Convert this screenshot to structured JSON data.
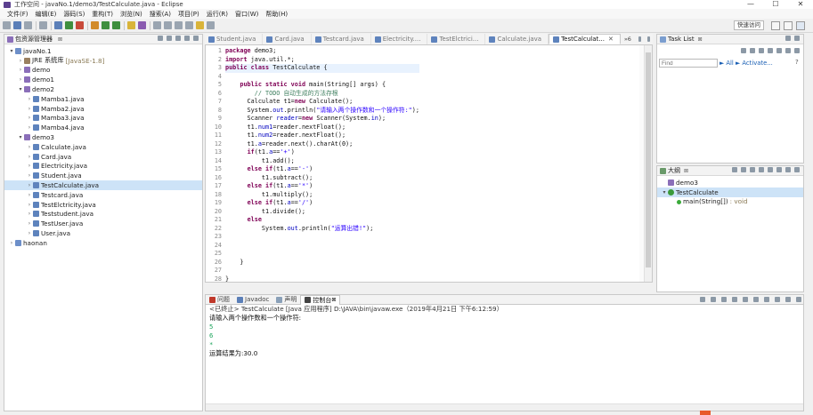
{
  "window": {
    "title": "工作空间 - javaNo.1/demo3/TestCalculate.java - Eclipse",
    "controls": [
      "—",
      "☐",
      "✕"
    ]
  },
  "menu": [
    "文件(F)",
    "编辑(E)",
    "源码(S)",
    "重构(T)",
    "浏览(N)",
    "搜索(A)",
    "项目(P)",
    "运行(R)",
    "窗口(W)",
    "帮助(H)"
  ],
  "toolbar": {
    "quick_access": "快速访问"
  },
  "package_explorer": {
    "title": "包资源管理器",
    "rows": [
      {
        "text": "javaNo.1",
        "indent": 0,
        "arrow": "▾",
        "icon": "proj"
      },
      {
        "text": "JRE 系统库",
        "extra": "[JavaSE-1.8]",
        "indent": 1,
        "arrow": "›",
        "icon": "jar"
      },
      {
        "text": "demo",
        "indent": 1,
        "arrow": "›",
        "icon": "pkg"
      },
      {
        "text": "demo1",
        "indent": 1,
        "arrow": "›",
        "icon": "pkg"
      },
      {
        "text": "demo2",
        "indent": 1,
        "arrow": "▾",
        "icon": "pkg"
      },
      {
        "text": "Mamba1.java",
        "indent": 2,
        "arrow": "›",
        "icon": "java"
      },
      {
        "text": "Mamba2.java",
        "indent": 2,
        "arrow": "›",
        "icon": "java"
      },
      {
        "text": "Mamba3.java",
        "indent": 2,
        "arrow": "›",
        "icon": "java"
      },
      {
        "text": "Mamba4.java",
        "indent": 2,
        "arrow": "›",
        "icon": "java"
      },
      {
        "text": "demo3",
        "indent": 1,
        "arrow": "▾",
        "icon": "pkg"
      },
      {
        "text": "Calculate.java",
        "indent": 2,
        "arrow": "›",
        "icon": "java"
      },
      {
        "text": "Card.java",
        "indent": 2,
        "arrow": "›",
        "icon": "java"
      },
      {
        "text": "Electricity.java",
        "indent": 2,
        "arrow": "›",
        "icon": "java"
      },
      {
        "text": "Student.java",
        "indent": 2,
        "arrow": "›",
        "icon": "java"
      },
      {
        "text": "TestCalculate.java",
        "indent": 2,
        "arrow": "›",
        "icon": "java",
        "selected": true
      },
      {
        "text": "Testcard.java",
        "indent": 2,
        "arrow": "›",
        "icon": "java"
      },
      {
        "text": "TestElctricity.java",
        "indent": 2,
        "arrow": "›",
        "icon": "java"
      },
      {
        "text": "Teststudent.java",
        "indent": 2,
        "arrow": "›",
        "icon": "java"
      },
      {
        "text": "TestUser.java",
        "indent": 2,
        "arrow": "›",
        "icon": "java"
      },
      {
        "text": "User.java",
        "indent": 2,
        "arrow": "›",
        "icon": "java"
      },
      {
        "text": "haonan",
        "indent": 0,
        "arrow": "›",
        "icon": "proj"
      }
    ]
  },
  "editor": {
    "tabs": [
      "Student.java",
      "Card.java",
      "Testcard.java",
      "Electricity....",
      "TestElctrici...",
      "Calculate.java",
      "TestCalculat..."
    ],
    "active_tab": 6,
    "overflow": "»6",
    "lines": [
      [
        {
          "t": "package",
          "c": "kw"
        },
        {
          "t": " demo3;"
        }
      ],
      [
        {
          "t": "import",
          "c": "kw"
        },
        {
          "t": " java.util.*;"
        }
      ],
      [
        {
          "t": "public class",
          "c": "kw"
        },
        {
          "t": " TestCalculate {"
        }
      ],
      [
        {
          "t": ""
        }
      ],
      [
        {
          "t": "    "
        },
        {
          "t": "public static void",
          "c": "kw"
        },
        {
          "t": " main(String[] args) {"
        }
      ],
      [
        {
          "t": "        "
        },
        {
          "t": "// TODO 自动生成的方法存根",
          "c": "cmt"
        }
      ],
      [
        {
          "t": "      Calculate t1="
        },
        {
          "t": "new",
          "c": "kw"
        },
        {
          "t": " Calculate();"
        }
      ],
      [
        {
          "t": "      System."
        },
        {
          "t": "out",
          "c": "fld"
        },
        {
          "t": ".println("
        },
        {
          "t": "\"请输入两个操作数和一个操作符:\"",
          "c": "str"
        },
        {
          "t": ");"
        }
      ],
      [
        {
          "t": "      Scanner "
        },
        {
          "t": "reader",
          "c": "fld"
        },
        {
          "t": "="
        },
        {
          "t": "new",
          "c": "kw"
        },
        {
          "t": " Scanner(System."
        },
        {
          "t": "in",
          "c": "fld"
        },
        {
          "t": ");"
        }
      ],
      [
        {
          "t": "      t1."
        },
        {
          "t": "num1",
          "c": "fld"
        },
        {
          "t": "=reader.nextFloat();"
        }
      ],
      [
        {
          "t": "      t1."
        },
        {
          "t": "num2",
          "c": "fld"
        },
        {
          "t": "=reader.nextFloat();"
        }
      ],
      [
        {
          "t": "      t1."
        },
        {
          "t": "a",
          "c": "fld"
        },
        {
          "t": "=reader.next().charAt(0);"
        }
      ],
      [
        {
          "t": "      "
        },
        {
          "t": "if",
          "c": "kw"
        },
        {
          "t": "(t1."
        },
        {
          "t": "a",
          "c": "fld"
        },
        {
          "t": "=="
        },
        {
          "t": "'+'",
          "c": "str"
        },
        {
          "t": ")"
        }
      ],
      [
        {
          "t": "          t1.add();"
        }
      ],
      [
        {
          "t": "      "
        },
        {
          "t": "else if",
          "c": "kw"
        },
        {
          "t": "(t1."
        },
        {
          "t": "a",
          "c": "fld"
        },
        {
          "t": "=="
        },
        {
          "t": "'-'",
          "c": "str"
        },
        {
          "t": ")"
        }
      ],
      [
        {
          "t": "          t1.subtract();"
        }
      ],
      [
        {
          "t": "      "
        },
        {
          "t": "else if",
          "c": "kw"
        },
        {
          "t": "(t1."
        },
        {
          "t": "a",
          "c": "fld"
        },
        {
          "t": "=="
        },
        {
          "t": "'*'",
          "c": "str"
        },
        {
          "t": ")"
        }
      ],
      [
        {
          "t": "          t1.multiply();"
        }
      ],
      [
        {
          "t": "      "
        },
        {
          "t": "else if",
          "c": "kw"
        },
        {
          "t": "(t1."
        },
        {
          "t": "a",
          "c": "fld"
        },
        {
          "t": "=="
        },
        {
          "t": "'/'",
          "c": "str"
        },
        {
          "t": ")"
        }
      ],
      [
        {
          "t": "          t1.divide();"
        }
      ],
      [
        {
          "t": "      "
        },
        {
          "t": "else",
          "c": "kw"
        }
      ],
      [
        {
          "t": "          System."
        },
        {
          "t": "out",
          "c": "fld"
        },
        {
          "t": ".println("
        },
        {
          "t": "\"运算出错!\"",
          "c": "str"
        },
        {
          "t": ");"
        }
      ],
      [
        {
          "t": ""
        }
      ],
      [
        {
          "t": ""
        }
      ],
      [
        {
          "t": ""
        }
      ],
      [
        {
          "t": "    }"
        }
      ],
      [
        {
          "t": ""
        }
      ],
      [
        {
          "t": "}"
        }
      ]
    ]
  },
  "task_list": {
    "title": "Task List",
    "find_placeholder": "Find",
    "all": "All",
    "activate": "Activate..."
  },
  "outline": {
    "title": "大纲",
    "rows": [
      {
        "text": "demo3",
        "indent": 0,
        "arrow": "",
        "icon": "pkg"
      },
      {
        "text": "TestCalculate",
        "indent": 0,
        "arrow": "▾",
        "icon": "cls",
        "selected": true
      },
      {
        "text": "main(String[])",
        "extra": " : void",
        "indent": 1,
        "arrow": "",
        "icon": "meth"
      }
    ]
  },
  "bottom": {
    "tabs": [
      "问题",
      "Javadoc",
      "声明",
      "控制台"
    ],
    "active_tab": 3,
    "header": "<已终止> TestCalculate [Java 应用程序] D:\\JAVA\\bin\\javaw.exe（2019年4月21日 下午6:12:59）",
    "lines": [
      {
        "t": "请输入两个操作数和一个操作符:",
        "k": "out"
      },
      {
        "t": "5",
        "k": "in"
      },
      {
        "t": "6",
        "k": "in"
      },
      {
        "t": "*",
        "k": "in"
      },
      {
        "t": "运算结果为:30.0",
        "k": "out"
      }
    ]
  }
}
